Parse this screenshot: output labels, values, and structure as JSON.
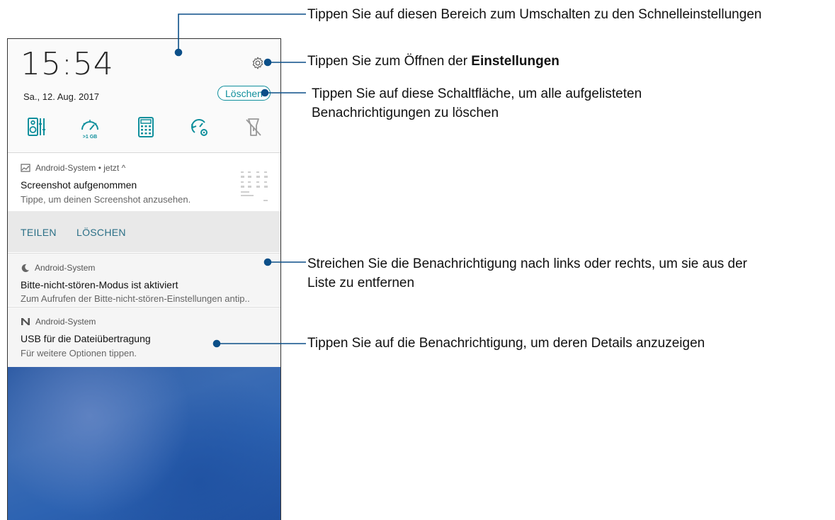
{
  "header": {
    "time": "15:54",
    "date": "Sa., 12. Aug. 2017",
    "clear_button": "Löschen",
    "settings_icon": "gear-icon",
    "quick_settings": [
      "audio-equalizer-icon",
      "boost-memory-icon",
      "calculator-icon",
      "power-settings-icon",
      "flashlight-off-icon"
    ],
    "boost_label": ">1 GB"
  },
  "notifications": [
    {
      "app": "Android-System • jetzt ^",
      "icon": "image-icon",
      "title": "Screenshot aufgenommen",
      "text": "Tippe, um deinen Screenshot anzusehen.",
      "actions": [
        "TEILEN",
        "LÖSCHEN"
      ]
    },
    {
      "app": "Android-System",
      "icon": "moon-icon",
      "title": "Bitte-nicht-stören-Modus ist aktiviert",
      "text": "Zum Aufrufen der Bitte-nicht-stören-Einstellungen antip.."
    },
    {
      "app": "Android-System",
      "icon": "n-logo-icon",
      "title": "USB für die Dateiübertragung",
      "text": "Für weitere Optionen tippen."
    }
  ],
  "annotations": {
    "quick_settings": "Tippen Sie auf diesen Bereich zum Umschalten zu den Schnelleinstellungen",
    "settings_prefix": "Tippen Sie zum Öffnen der ",
    "settings_bold": "Einstellungen",
    "clear_line1": "Tippen Sie auf diese Schaltfläche, um alle aufgelisteten",
    "clear_line2": "Benachrichtigungen zu löschen",
    "swipe_line1": "Streichen Sie die Benachrichtigung nach links oder rechts, um sie aus der",
    "swipe_line2": "Liste zu entfernen",
    "tap_details": "Tippen Sie auf die Benachrichtigung, um deren Details anzuzeigen"
  },
  "colors": {
    "accent": "#0f8f9c",
    "leader": "#0b4f88",
    "wallpaper": "#2d63b2"
  }
}
